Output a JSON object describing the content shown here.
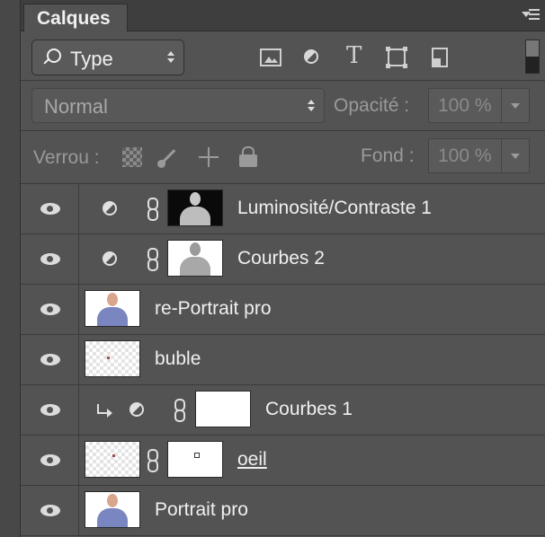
{
  "panel": {
    "title": "Calques",
    "menu_icon": "panel-menu-icon"
  },
  "filter": {
    "kind_label": "Type",
    "icons": [
      "pixel-layer-filter-icon",
      "adjustment-layer-filter-icon",
      "type-layer-filter-icon",
      "shape-layer-filter-icon",
      "smart-object-filter-icon"
    ],
    "text_icon_glyph": "T"
  },
  "blend": {
    "mode": "Normal",
    "opacity_label": "Opacité :",
    "opacity_value": "100 %"
  },
  "lock": {
    "label": "Verrou :",
    "fill_label": "Fond :",
    "fill_value": "100 %",
    "icons": [
      "lock-transparent-pixels-icon",
      "lock-image-pixels-icon",
      "lock-position-icon",
      "lock-all-icon"
    ]
  },
  "layers": [
    {
      "name": "Luminosité/Contraste 1",
      "type": "adjustment",
      "visible": true,
      "thumb": "dark-portrait"
    },
    {
      "name": "Courbes 2",
      "type": "adjustment",
      "visible": true,
      "thumb": "light-portrait"
    },
    {
      "name": "re-Portrait pro",
      "type": "pixel",
      "visible": true,
      "thumb": "color-portrait"
    },
    {
      "name": "buble",
      "type": "pixel",
      "visible": true,
      "thumb": "transparent"
    },
    {
      "name": "Courbes 1",
      "type": "adjustment",
      "clipped": true,
      "visible": true,
      "thumb": "white-mask"
    },
    {
      "name": "oeil",
      "type": "pixel-with-mask",
      "visible": true,
      "thumb": "transparent"
    },
    {
      "name": "Portrait pro",
      "type": "pixel",
      "visible": true,
      "thumb": "color-portrait"
    }
  ],
  "colors": {
    "panel_bg": "#535353",
    "tab_bar": "#3e3e3e",
    "text": "#f0f0f0",
    "dim_text": "#9a9a9a"
  }
}
